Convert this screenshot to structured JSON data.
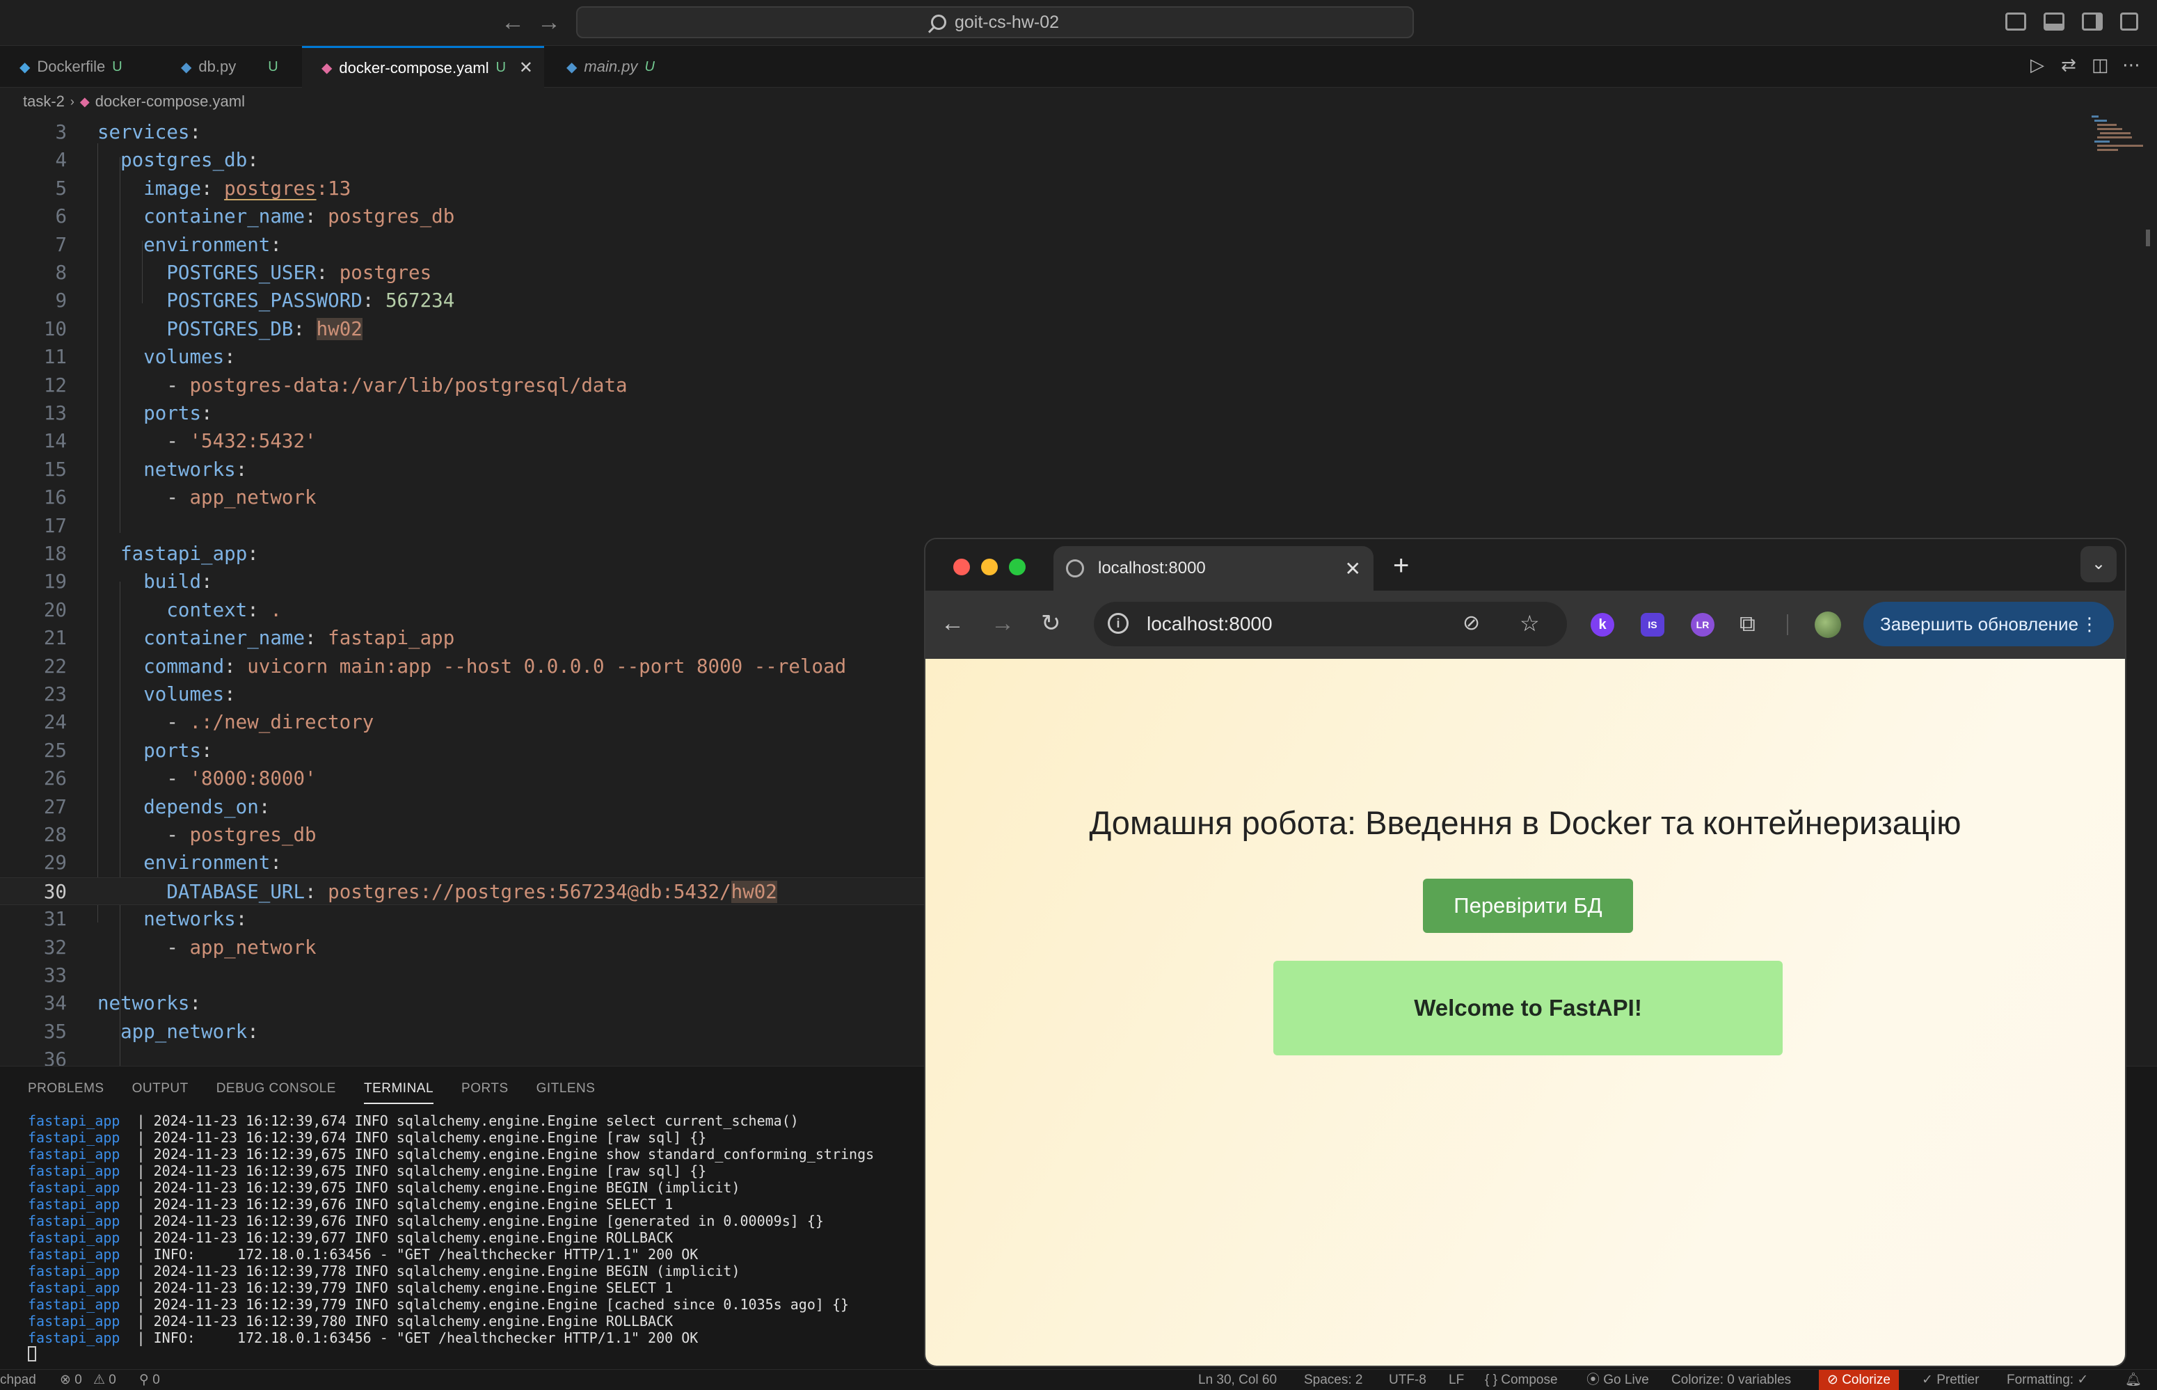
{
  "vscode": {
    "command_center": "goit-cs-hw-02",
    "tabs": [
      {
        "icon": "docker-icon",
        "name": "Dockerfile",
        "status": "U"
      },
      {
        "icon": "python-icon",
        "name": "db.py",
        "status": "U"
      },
      {
        "icon": "docker-compose-icon",
        "name": "docker-compose.yaml",
        "status": "U"
      },
      {
        "icon": "python-icon",
        "name": "main.py",
        "status": "U"
      }
    ],
    "close_glyph": "✕",
    "breadcrumb": {
      "folder": "task-2",
      "file": "docker-compose.yaml"
    },
    "editor": {
      "current_line": 30,
      "lines": [
        {
          "n": 3,
          "tokens": [
            [
              "k",
              "services"
            ],
            [
              "p",
              ":"
            ]
          ]
        },
        {
          "n": 4,
          "tokens": [
            [
              "p",
              "  "
            ],
            [
              "k",
              "postgres_db"
            ],
            [
              "p",
              ":"
            ]
          ]
        },
        {
          "n": 5,
          "tokens": [
            [
              "p",
              "    "
            ],
            [
              "k",
              "image"
            ],
            [
              "p",
              ": "
            ],
            [
              "s u",
              "postgres"
            ],
            [
              "s",
              ":13"
            ]
          ]
        },
        {
          "n": 6,
          "tokens": [
            [
              "p",
              "    "
            ],
            [
              "k",
              "container_name"
            ],
            [
              "p",
              ": "
            ],
            [
              "s",
              "postgres_db"
            ]
          ]
        },
        {
          "n": 7,
          "tokens": [
            [
              "p",
              "    "
            ],
            [
              "k",
              "environment"
            ],
            [
              "p",
              ":"
            ]
          ]
        },
        {
          "n": 8,
          "tokens": [
            [
              "p",
              "      "
            ],
            [
              "k",
              "POSTGRES_USER"
            ],
            [
              "p",
              ": "
            ],
            [
              "s",
              "postgres"
            ]
          ]
        },
        {
          "n": 9,
          "tokens": [
            [
              "p",
              "      "
            ],
            [
              "k",
              "POSTGRES_PASSWORD"
            ],
            [
              "p",
              ": "
            ],
            [
              "n",
              "567234"
            ]
          ]
        },
        {
          "n": 10,
          "tokens": [
            [
              "p",
              "      "
            ],
            [
              "k",
              "POSTGRES_DB"
            ],
            [
              "p",
              ": "
            ],
            [
              "s hl",
              "hw02"
            ]
          ]
        },
        {
          "n": 11,
          "tokens": [
            [
              "p",
              "    "
            ],
            [
              "k",
              "volumes"
            ],
            [
              "p",
              ":"
            ]
          ]
        },
        {
          "n": 12,
          "tokens": [
            [
              "p",
              "      - "
            ],
            [
              "s",
              "postgres-data:/var/lib/postgresql/data"
            ]
          ]
        },
        {
          "n": 13,
          "tokens": [
            [
              "p",
              "    "
            ],
            [
              "k",
              "ports"
            ],
            [
              "p",
              ":"
            ]
          ]
        },
        {
          "n": 14,
          "tokens": [
            [
              "p",
              "      - "
            ],
            [
              "s",
              "'5432:5432'"
            ]
          ]
        },
        {
          "n": 15,
          "tokens": [
            [
              "p",
              "    "
            ],
            [
              "k",
              "networks"
            ],
            [
              "p",
              ":"
            ]
          ]
        },
        {
          "n": 16,
          "tokens": [
            [
              "p",
              "      - "
            ],
            [
              "s",
              "app_network"
            ]
          ]
        },
        {
          "n": 17,
          "tokens": []
        },
        {
          "n": 18,
          "tokens": [
            [
              "p",
              "  "
            ],
            [
              "k",
              "fastapi_app"
            ],
            [
              "p",
              ":"
            ]
          ]
        },
        {
          "n": 19,
          "tokens": [
            [
              "p",
              "    "
            ],
            [
              "k",
              "build"
            ],
            [
              "p",
              ":"
            ]
          ]
        },
        {
          "n": 20,
          "tokens": [
            [
              "p",
              "      "
            ],
            [
              "k",
              "context"
            ],
            [
              "p",
              ": "
            ],
            [
              "s",
              "."
            ]
          ]
        },
        {
          "n": 21,
          "tokens": [
            [
              "p",
              "    "
            ],
            [
              "k",
              "container_name"
            ],
            [
              "p",
              ": "
            ],
            [
              "s",
              "fastapi_app"
            ]
          ]
        },
        {
          "n": 22,
          "tokens": [
            [
              "p",
              "    "
            ],
            [
              "k",
              "command"
            ],
            [
              "p",
              ": "
            ],
            [
              "s",
              "uvicorn main:app --host 0.0.0.0 --port 8000 --reload"
            ]
          ]
        },
        {
          "n": 23,
          "tokens": [
            [
              "p",
              "    "
            ],
            [
              "k",
              "volumes"
            ],
            [
              "p",
              ":"
            ]
          ]
        },
        {
          "n": 24,
          "tokens": [
            [
              "p",
              "      - "
            ],
            [
              "s",
              ".:/new_directory"
            ]
          ]
        },
        {
          "n": 25,
          "tokens": [
            [
              "p",
              "    "
            ],
            [
              "k",
              "ports"
            ],
            [
              "p",
              ":"
            ]
          ]
        },
        {
          "n": 26,
          "tokens": [
            [
              "p",
              "      - "
            ],
            [
              "s",
              "'8000:8000'"
            ]
          ]
        },
        {
          "n": 27,
          "tokens": [
            [
              "p",
              "    "
            ],
            [
              "k",
              "depends_on"
            ],
            [
              "p",
              ":"
            ]
          ]
        },
        {
          "n": 28,
          "tokens": [
            [
              "p",
              "      - "
            ],
            [
              "s",
              "postgres_db"
            ]
          ]
        },
        {
          "n": 29,
          "tokens": [
            [
              "p",
              "    "
            ],
            [
              "k",
              "environment"
            ],
            [
              "p",
              ":"
            ]
          ]
        },
        {
          "n": 30,
          "tokens": [
            [
              "p",
              "      "
            ],
            [
              "k",
              "DATABASE_URL"
            ],
            [
              "p",
              ": "
            ],
            [
              "s",
              "postgres://postgres:567234@db:5432/"
            ],
            [
              "s hl",
              "hw02"
            ]
          ]
        },
        {
          "n": 31,
          "tokens": [
            [
              "p",
              "    "
            ],
            [
              "k",
              "networks"
            ],
            [
              "p",
              ":"
            ]
          ]
        },
        {
          "n": 32,
          "tokens": [
            [
              "p",
              "      - "
            ],
            [
              "s",
              "app_network"
            ]
          ]
        },
        {
          "n": 33,
          "tokens": []
        },
        {
          "n": 34,
          "tokens": [
            [
              "k",
              "networks"
            ],
            [
              "p",
              ":"
            ]
          ]
        },
        {
          "n": 35,
          "tokens": [
            [
              "p",
              "  "
            ],
            [
              "k",
              "app_network"
            ],
            [
              "p",
              ":"
            ]
          ]
        },
        {
          "n": 36,
          "tokens": []
        }
      ]
    },
    "panel_tabs": [
      {
        "label": "PROBLEMS",
        "active": false
      },
      {
        "label": "OUTPUT",
        "active": false
      },
      {
        "label": "DEBUG CONSOLE",
        "active": false
      },
      {
        "label": "TERMINAL",
        "active": true
      },
      {
        "label": "PORTS",
        "active": false
      },
      {
        "label": "GITLENS",
        "active": false
      }
    ],
    "terminal_lines": [
      {
        "service": "fastapi_app",
        "text": "  | 2024-11-23 16:12:39,674 INFO sqlalchemy.engine.Engine select current_schema()"
      },
      {
        "service": "fastapi_app",
        "text": "  | 2024-11-23 16:12:39,674 INFO sqlalchemy.engine.Engine [raw sql] {}"
      },
      {
        "service": "fastapi_app",
        "text": "  | 2024-11-23 16:12:39,675 INFO sqlalchemy.engine.Engine show standard_conforming_strings"
      },
      {
        "service": "fastapi_app",
        "text": "  | 2024-11-23 16:12:39,675 INFO sqlalchemy.engine.Engine [raw sql] {}"
      },
      {
        "service": "fastapi_app",
        "text": "  | 2024-11-23 16:12:39,675 INFO sqlalchemy.engine.Engine BEGIN (implicit)"
      },
      {
        "service": "fastapi_app",
        "text": "  | 2024-11-23 16:12:39,676 INFO sqlalchemy.engine.Engine SELECT 1"
      },
      {
        "service": "fastapi_app",
        "text": "  | 2024-11-23 16:12:39,676 INFO sqlalchemy.engine.Engine [generated in 0.00009s] {}"
      },
      {
        "service": "fastapi_app",
        "text": "  | 2024-11-23 16:12:39,677 INFO sqlalchemy.engine.Engine ROLLBACK"
      },
      {
        "service": "fastapi_app",
        "text": "  | INFO:     172.18.0.1:63456 - \"GET /healthchecker HTTP/1.1\" 200 OK"
      },
      {
        "service": "fastapi_app",
        "text": "  | 2024-11-23 16:12:39,778 INFO sqlalchemy.engine.Engine BEGIN (implicit)"
      },
      {
        "service": "fastapi_app",
        "text": "  | 2024-11-23 16:12:39,779 INFO sqlalchemy.engine.Engine SELECT 1"
      },
      {
        "service": "fastapi_app",
        "text": "  | 2024-11-23 16:12:39,779 INFO sqlalchemy.engine.Engine [cached since 0.1035s ago] {}"
      },
      {
        "service": "fastapi_app",
        "text": "  | 2024-11-23 16:12:39,780 INFO sqlalchemy.engine.Engine ROLLBACK"
      },
      {
        "service": "fastapi_app",
        "text": "  | INFO:     172.18.0.1:63456 - \"GET /healthchecker HTTP/1.1\" 200 OK"
      }
    ],
    "statusbar": {
      "left_text": "chpad",
      "errors": "⊗ 0",
      "warnings": "⚠ 0",
      "ports": "⚲ 0",
      "position": "Ln 30, Col 60",
      "spaces": "Spaces: 2",
      "encoding": "UTF-8",
      "eol": "LF",
      "language": "{ } Compose",
      "golive": "⦿ Go Live",
      "colorize_vars": "Colorize: 0 variables",
      "colorize": "⊘ Colorize",
      "prettier": "✓ Prettier",
      "formatting": "Formatting: ✓"
    }
  },
  "browser": {
    "tab_title": "localhost:8000",
    "url": "localhost:8000",
    "newtab": "+",
    "tabsearch": "⌄",
    "update_button": "Завершить обновление",
    "update_menu": "⋮",
    "extensions": [
      {
        "name": "k-extension-icon",
        "label": "k",
        "color": "#7e3ff2"
      },
      {
        "name": "is-extension-icon",
        "label": "IS",
        "color": "#5b3fd8"
      },
      {
        "name": "lr-extension-icon",
        "label": "LR",
        "color": "#8a4fd8"
      }
    ],
    "page": {
      "heading": "Домашня робота: Введення в Docker та контейнеризацію",
      "button": "Перевірити БД",
      "message": "Welcome to FastAPI!"
    }
  }
}
